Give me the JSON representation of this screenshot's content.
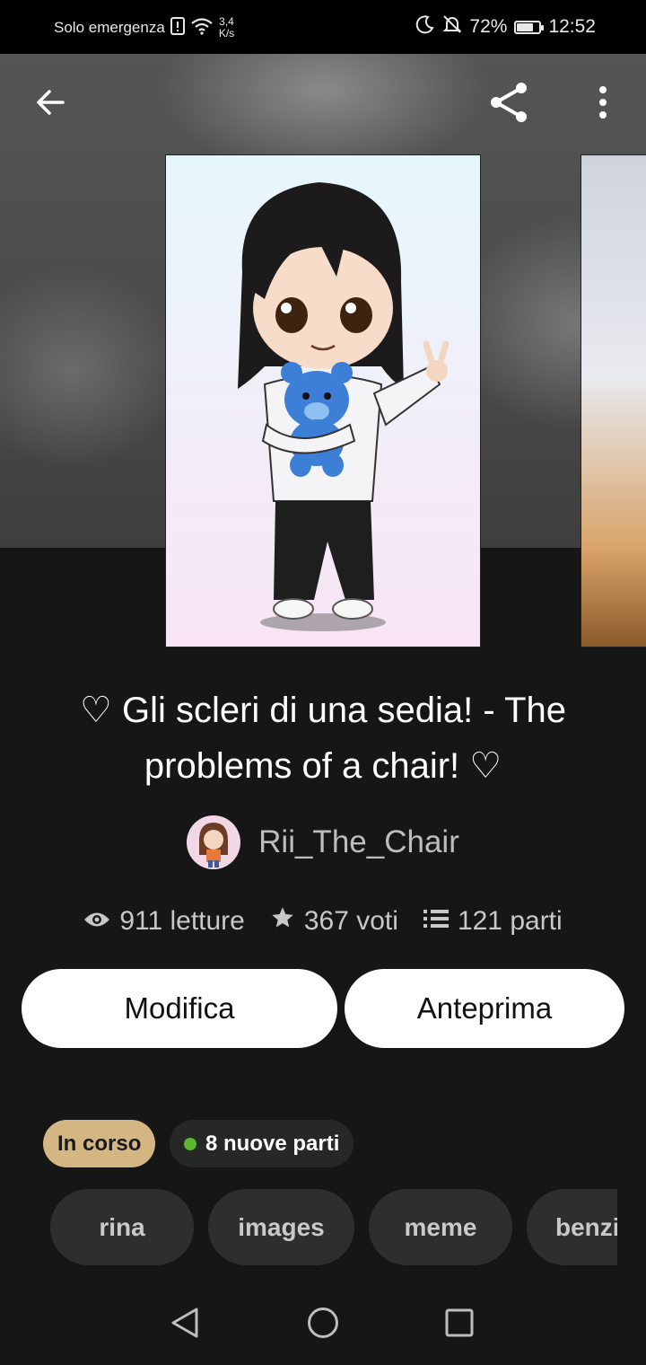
{
  "status_bar": {
    "carrier": "Solo emergenza",
    "net_speed_value": "3,4",
    "net_speed_unit": "K/s",
    "battery": "72%",
    "battery_level": 0.72,
    "time": "12:52"
  },
  "toolbar": {
    "back_icon": "arrow-left-icon",
    "share_icon": "share-icon",
    "more_icon": "more-vertical-icon"
  },
  "story": {
    "title": "♡ Gli scleri di una sedia! - The problems of a chair! ♡",
    "author": "Rii_The_Chair",
    "stats": {
      "reads": "911 letture",
      "votes": "367 voti",
      "parts": "121 parti"
    }
  },
  "actions": {
    "edit_label": "Modifica",
    "preview_label": "Anteprima"
  },
  "badges": {
    "status": "In corso",
    "new_parts": "8 nuove parti"
  },
  "tags": [
    "rina",
    "images",
    "meme",
    "benzi"
  ],
  "colors": {
    "background": "#161616",
    "status_badge": "#d4b683",
    "new_parts_dot": "#5cb82e"
  }
}
